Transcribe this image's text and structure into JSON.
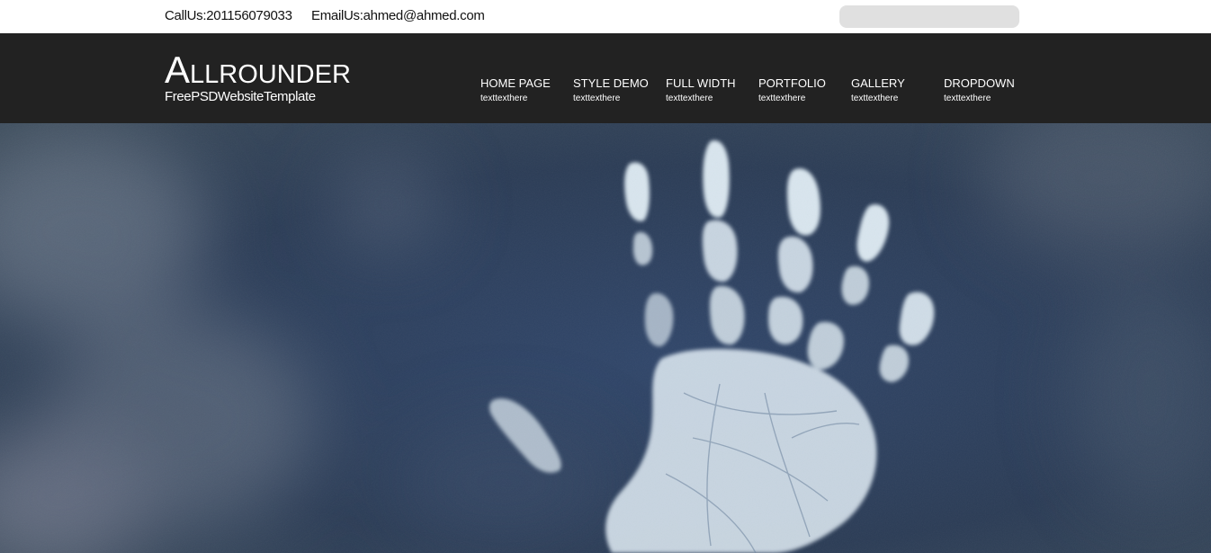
{
  "topbar": {
    "call_text": "CallUs:201156079033",
    "email_text": "EmailUs:ahmed@ahmed.com",
    "search": {
      "value": "",
      "placeholder": ""
    }
  },
  "header": {
    "logo_first_letter": "A",
    "logo_rest": "LLROUNDER",
    "tagline": "FreePSDWebsiteTemplate"
  },
  "nav": {
    "items": [
      {
        "label": "HOME PAGE",
        "sub": "texttexthere"
      },
      {
        "label": "STYLE DEMO",
        "sub": "texttexthere"
      },
      {
        "label": "FULL WIDTH",
        "sub": "texttexthere"
      },
      {
        "label": "PORTFOLIO",
        "sub": "texttexthere"
      },
      {
        "label": "GALLERY",
        "sub": "texttexthere"
      },
      {
        "label": "DROPDOWN",
        "sub": "texttexthere"
      }
    ]
  },
  "hero": {
    "image": "handprint-on-dark-blue-smoky-background"
  },
  "colors": {
    "header_bg": "#222222",
    "topbar_bg": "#ffffff",
    "search_bg": "#e0e0e0",
    "hero_bg": "#2e3f58",
    "handprint": "#d9e6ef"
  }
}
